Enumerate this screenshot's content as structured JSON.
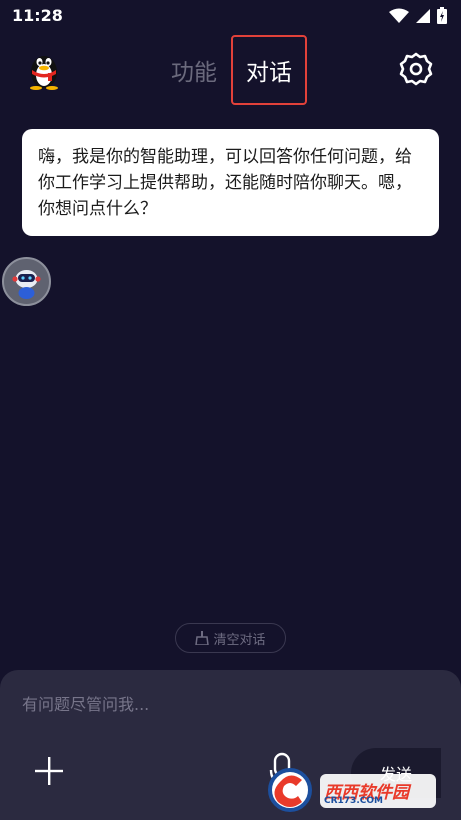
{
  "status_bar": {
    "time": "11:28"
  },
  "header": {
    "tab_function": "功能",
    "tab_chat": "对话"
  },
  "chat": {
    "welcome_message": "嗨，我是你的智能助理，可以回答你任何问题，给你工作学习上提供帮助，还能随时陪你聊天。嗯，你想问点什么？"
  },
  "clear_chat_label": "清空对话",
  "composer": {
    "placeholder": "有问题尽管问我...",
    "send_label": "发送"
  },
  "watermark": {
    "name": "西西软件园",
    "domain": "CR173.COM"
  },
  "colors": {
    "background": "#14122b",
    "panel": "#2b2a40",
    "active_tab_border": "#e2413a"
  }
}
